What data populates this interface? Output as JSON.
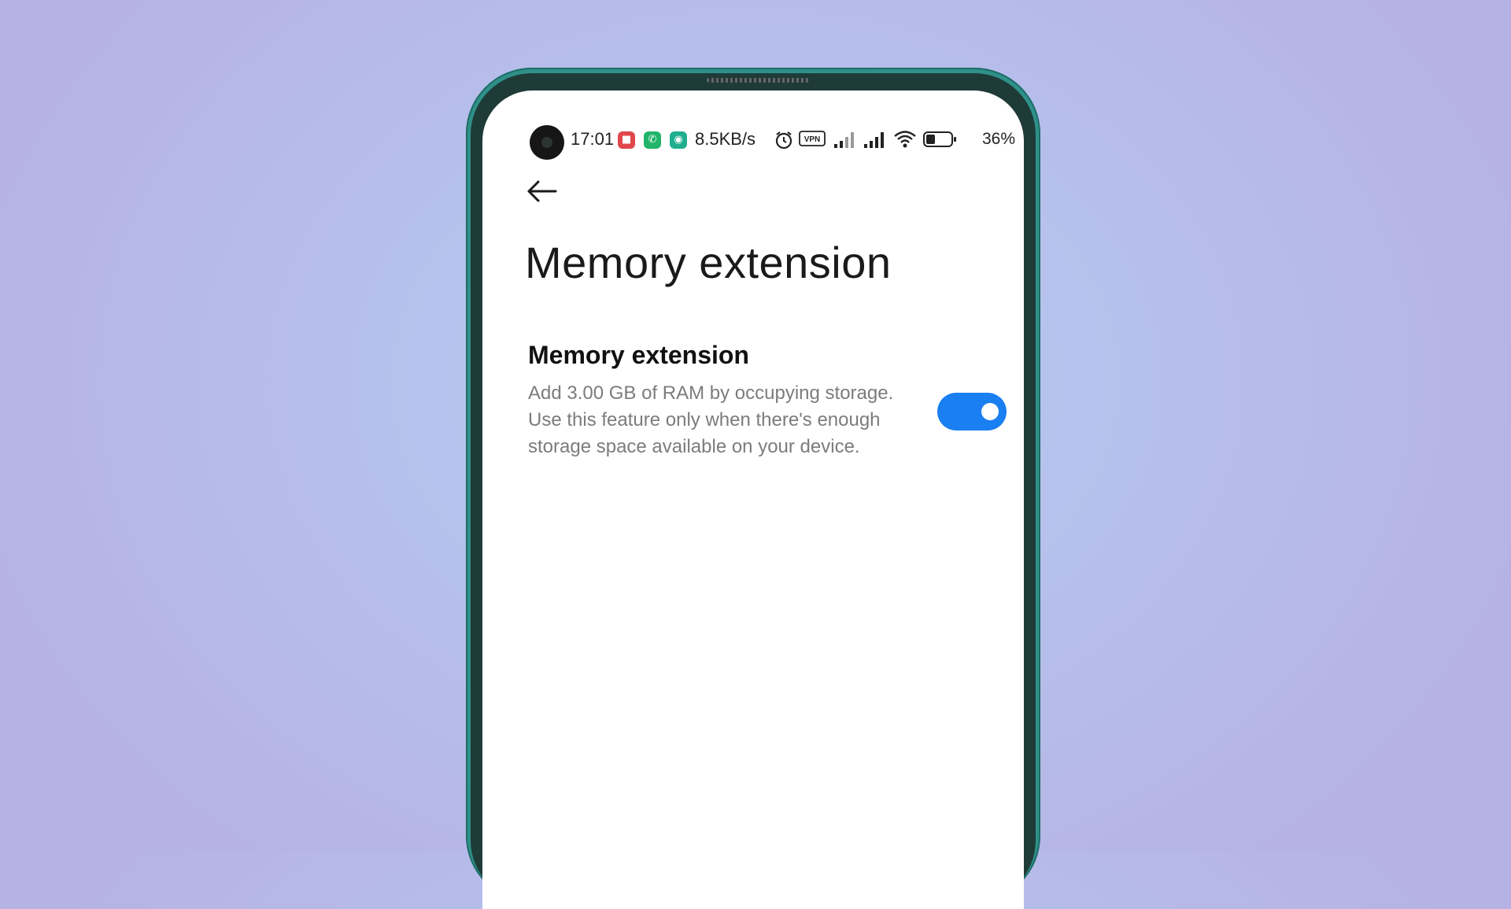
{
  "status_bar": {
    "time": "17:01",
    "network_speed": "8.5KB/s",
    "vpn_label": "VPN",
    "battery_percent": "36%",
    "battery_level": 0.36,
    "notification_icons": [
      "red-app-icon",
      "phone-app-icon",
      "green-app-icon"
    ],
    "indicator_icons": [
      "alarm-icon",
      "vpn-icon",
      "signal-icon",
      "signal-icon",
      "wifi-icon",
      "battery-icon"
    ]
  },
  "header": {
    "back_icon": "back-arrow-icon",
    "title": "Memory extension"
  },
  "settings": {
    "memory_extension": {
      "title": "Memory extension",
      "description": "Add 3.00 GB of RAM by occupying storage. Use this feature only when there's enough storage space available on your device.",
      "enabled": true
    }
  },
  "colors": {
    "toggle_on": "#1a7ff0",
    "background": "#b8c2ec",
    "phone_frame": "#2f9189"
  }
}
